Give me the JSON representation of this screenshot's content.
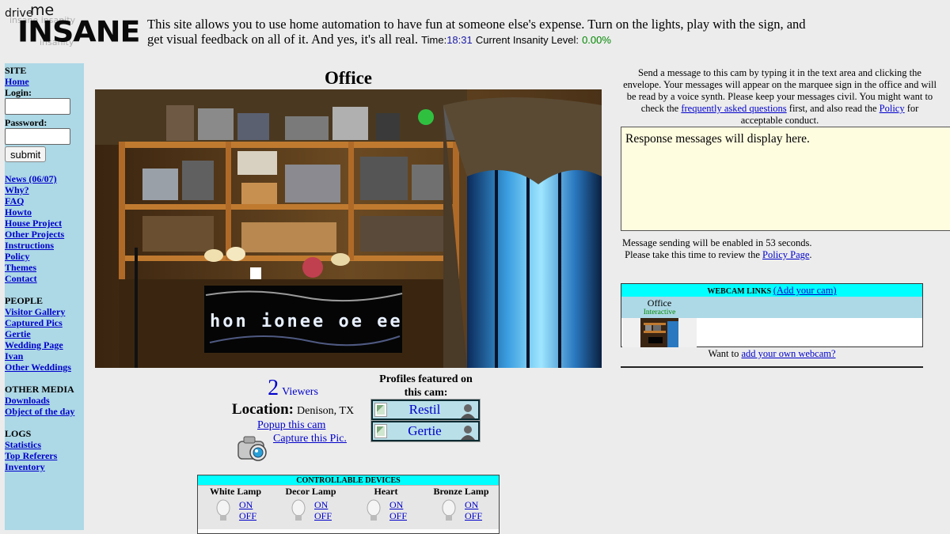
{
  "header": {
    "logo_drive": "drive",
    "logo_me": "me",
    "logo_insane": "INSANE",
    "intro_text": "This site allows you to use home automation to have fun at someone else's expense. Turn on the lights, play with the sign, and get visual feedback on all of it. And yes, it's all real.",
    "time_label": "Time:",
    "time_value": "18:31",
    "insanity_label": "Current Insanity Level:",
    "insanity_value": "0.00%"
  },
  "sidebar": {
    "site_head": "SITE",
    "home": "Home",
    "login_label": "Login:",
    "password_label": "Password:",
    "submit": "submit",
    "links1": [
      "News (06/07)",
      "Why?",
      "FAQ",
      "Howto",
      "House Project",
      "Other Projects",
      "Instructions",
      "Policy",
      "Themes",
      "Contact"
    ],
    "people_head": "PEOPLE",
    "people_links": [
      "Visitor Gallery",
      "Captured Pics",
      "Gertie",
      "Wedding Page",
      "Ivan",
      "Other Weddings"
    ],
    "media_head": "OTHER MEDIA",
    "media_links": [
      "Downloads",
      "Object of the day"
    ],
    "logs_head": "LOGS",
    "logs_links": [
      "Statistics",
      "Top Referers",
      "Inventory"
    ]
  },
  "cam": {
    "title": "Office",
    "viewers_count": "2",
    "viewers_label": "Viewers",
    "location_label": "Location:",
    "location_value": "Denison, TX",
    "popup_link": "Popup this cam",
    "capture_link": "Capture this Pic."
  },
  "profiles": {
    "title": "Profiles featured on this cam:",
    "names": [
      "Restil",
      "Gertie"
    ]
  },
  "devices": {
    "title": "CONTROLLABLE DEVICES",
    "names": [
      "White Lamp",
      "Decor Lamp",
      "Heart",
      "Bronze Lamp"
    ],
    "on_label": "ON",
    "off_label": "OFF"
  },
  "messages": {
    "note_part1": "Send a message to this cam by typing it in the text area and clicking the envelope. Your messages will appear on the marquee sign in the office and will be read by a voice synth. Please keep your messages civil. You might want to check the",
    "faq_link": "frequently asked questions",
    "note_part2": "first, and also read the",
    "policy_link": "Policy",
    "note_part3": "for acceptable conduct.",
    "response_text": "Response messages will display here.",
    "enable_text": "Message sending will be enabled in 53 seconds.",
    "review_text": "Please take this time to review the",
    "policy_page_link": "Policy Page"
  },
  "webcams": {
    "head": "WEBCAM LINKS",
    "add_link": "(Add your cam)",
    "cam_name": "Office",
    "cam_tag": "Interactive",
    "want_text": "Want to",
    "add_own_link": "add your own webcam?"
  }
}
